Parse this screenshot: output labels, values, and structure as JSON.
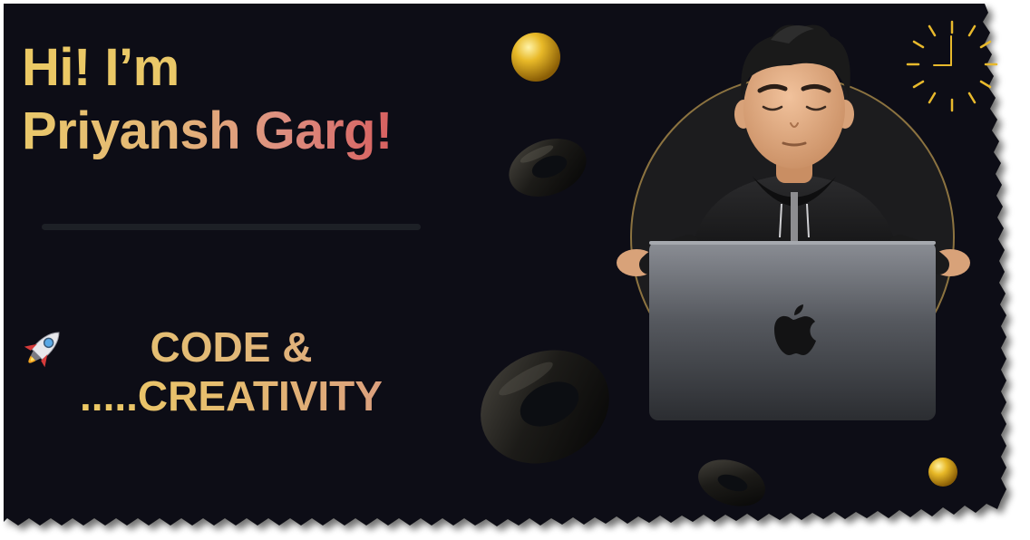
{
  "greeting": {
    "line1": "Hi! I’m",
    "line2": "Priyansh Garg!"
  },
  "tagline": {
    "line1": "CODE &",
    "line2": ".....CREATIVITY"
  },
  "icons": {
    "rocket": "rocket-icon",
    "clock": "clock-icon",
    "apple_logo": "apple-logo-icon"
  },
  "colors": {
    "background": "#0c0e12",
    "gold": "#ecc964",
    "coral": "#d76060",
    "ring_gold": "#8c7340"
  }
}
